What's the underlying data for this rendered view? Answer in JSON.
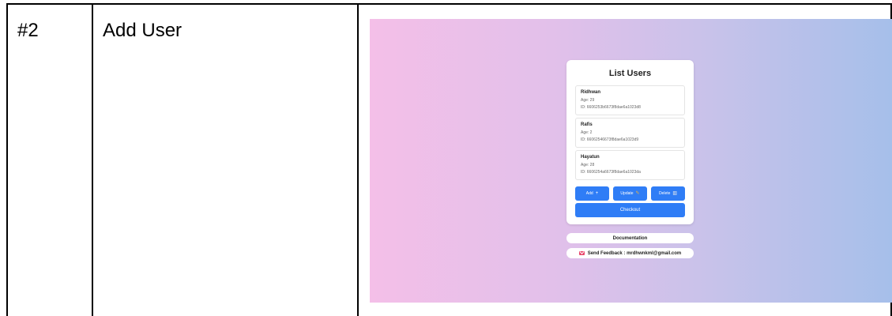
{
  "row": {
    "number": "#2",
    "title": "Add User"
  },
  "app": {
    "card_title": "List Users",
    "users": [
      {
        "name": "Ridhwan",
        "age": "Age: 29",
        "id": "ID: 6606253b6673f8dae6a1023d8"
      },
      {
        "name": "Rafis",
        "age": "Age: 2",
        "id": "ID: 66062546673f8dae6a1023d9"
      },
      {
        "name": "Hayatun",
        "age": "Age: 28",
        "id": "ID: 6606254a6673f8dae6a1023da"
      }
    ],
    "buttons": {
      "add": "Add",
      "update": "Update",
      "delete": "Delete",
      "checkout": "Checkout"
    },
    "documentation": "Documentation",
    "feedback": "Send Feedback : mrdhwnkml@gmail.com",
    "icons": {
      "add": "plus-icon",
      "update": "pencil-icon",
      "delete": "trash-icon",
      "feedback": "mail-icon"
    },
    "colors": {
      "primary_button": "#2f7df6",
      "background_start": "#f4bfe8",
      "background_end": "#a6bfea"
    }
  }
}
